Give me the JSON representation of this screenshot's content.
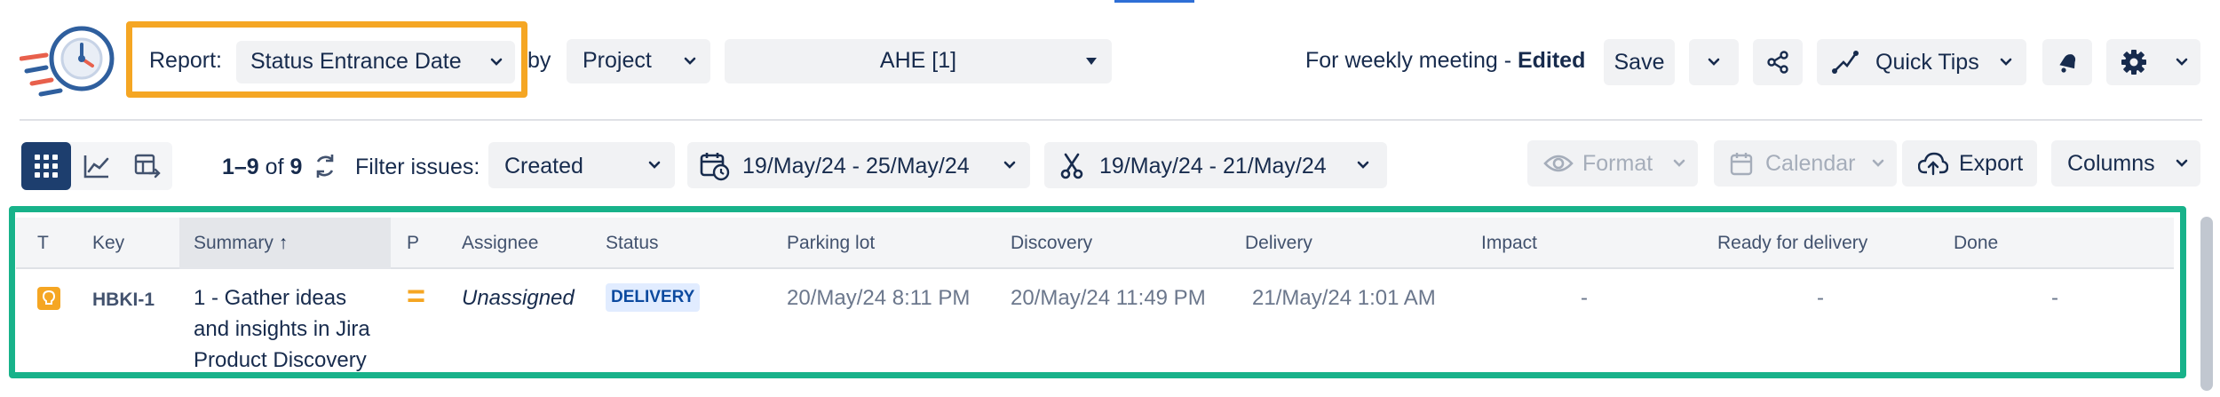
{
  "report": {
    "label": "Report:",
    "value": "Status Entrance Date",
    "by_label": "by",
    "group_by": "Project",
    "project_filter": "AHE [1]"
  },
  "saved_view": {
    "name": "For weekly meeting",
    "separator": " - ",
    "state": "Edited"
  },
  "toolbar": {
    "save_label": "Save",
    "quick_tips_label": "Quick Tips"
  },
  "results": {
    "range": "1–9",
    "of_label": "of",
    "total": "9"
  },
  "filters": {
    "label": "Filter issues:",
    "date_field": "Created",
    "date_range_1": "19/May/24 - 25/May/24",
    "date_range_2": "19/May/24 - 21/May/24"
  },
  "right_toolbar": {
    "format_label": "Format",
    "calendar_label": "Calendar",
    "export_label": "Export",
    "columns_label": "Columns"
  },
  "table": {
    "columns": [
      "T",
      "Key",
      "Summary",
      "P",
      "Assignee",
      "Status",
      "Parking lot",
      "Discovery",
      "Delivery",
      "Impact",
      "Ready for delivery",
      "Done"
    ],
    "sort_indicator": "↑",
    "rows": [
      {
        "key": "HBKI-1",
        "summary_lines": [
          "1 - Gather ideas",
          "and insights in Jira",
          "Product Discovery"
        ],
        "priority_symbol": "=",
        "assignee": "Unassigned",
        "status": "DELIVERY",
        "parking_lot": "20/May/24 8:11 PM",
        "discovery": "20/May/24 11:49 PM",
        "delivery": "21/May/24 1:01 AM",
        "impact": "-",
        "ready_for_delivery": "-",
        "done": "-"
      }
    ]
  },
  "colors": {
    "report_highlight": "#f5a623",
    "table_highlight": "#18b28a",
    "view_toggle_active": "#1d3e6e",
    "priority": "#f5a623",
    "status_badge_bg": "#e1ecff",
    "status_badge_text": "#0c4a9f"
  }
}
